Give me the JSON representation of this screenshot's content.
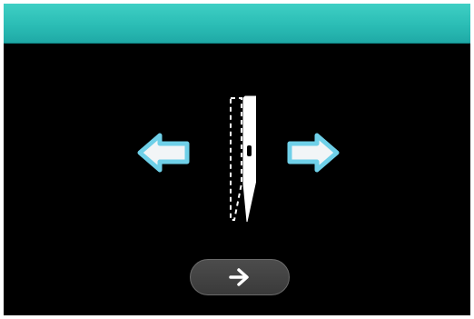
{
  "header": {
    "color": "#2bbdb5"
  },
  "controls": {
    "left_arrow_icon": "arrow-left-icon",
    "right_arrow_icon": "arrow-right-icon",
    "arrow_color": "#6fd0e8",
    "arrow_fill": "#f2f5f7"
  },
  "needle": {
    "icon": "sewing-needle-icon"
  },
  "next_button": {
    "icon": "arrow-right-icon",
    "background": "#444444"
  }
}
